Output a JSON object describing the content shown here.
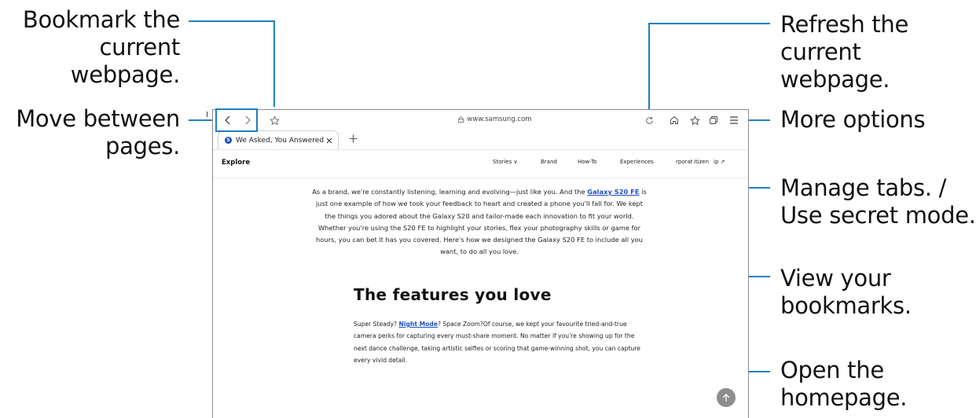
{
  "callouts": {
    "bookmark": [
      "Bookmark the",
      "current webpage."
    ],
    "move": [
      "Move between",
      "pages."
    ],
    "refresh": [
      "Refresh the current",
      "webpage."
    ],
    "more": [
      "More options"
    ],
    "tabs": [
      "Manage tabs. /",
      "Use secret mode."
    ],
    "bookmarks": [
      "View your",
      "bookmarks."
    ],
    "home": [
      "Open the",
      "homepage."
    ]
  },
  "browser": {
    "url": "www.samsung.com",
    "tab_title": "We Asked, You Answered, W...",
    "fragment": "I",
    "icons": {
      "back": "chevron-left-icon",
      "forward": "chevron-right-icon",
      "bookmark": "star-outline-icon",
      "lock": "lock-icon",
      "refresh": "refresh-icon",
      "home": "home-icon",
      "bookmarks": "star-list-icon",
      "tabs": "tabs-icon",
      "menu": "hamburger-icon",
      "close_tab": "close-icon",
      "new_tab": "plus-icon",
      "to_top": "arrow-up-icon"
    }
  },
  "site": {
    "explore": "Explore",
    "nav": [
      "Stories ∨",
      "Brand",
      "How-To",
      "Experiences",
      "rporat",
      "itizen",
      "ip ↗"
    ]
  },
  "article": {
    "intro_before": "As a brand, we're constantly listening, learning and evolving—just like you. And the ",
    "intro_link": "Galaxy S20 FE",
    "intro_after": " is just one example of how we took your feedback to heart and created a phone you'll fall for. We kept the things you adored about the Galaxy S20 and tailor-made each innovation to fit your world. Whether you're using the S20 FE to highlight your stories, flex your photography skills or game for hours, you can bet it has you covered. Here's how we designed the Galaxy S20 FE to include all you want, to do all you love.",
    "heading": "The features you love",
    "body_before": "Super Steady? ",
    "body_link": "Night Mode",
    "body_after": "? Space Zoom?Of course, we kept your favourite tried-and-true camera perks for capturing every must-share moment. No matter if you're showing up for the next dance challenge, taking artistic selfies or scoring that game-winning shot, you can capture every vivid detail."
  },
  "colors": {
    "callout_line": "#1f7fc1",
    "link": "#1e4fc4"
  }
}
